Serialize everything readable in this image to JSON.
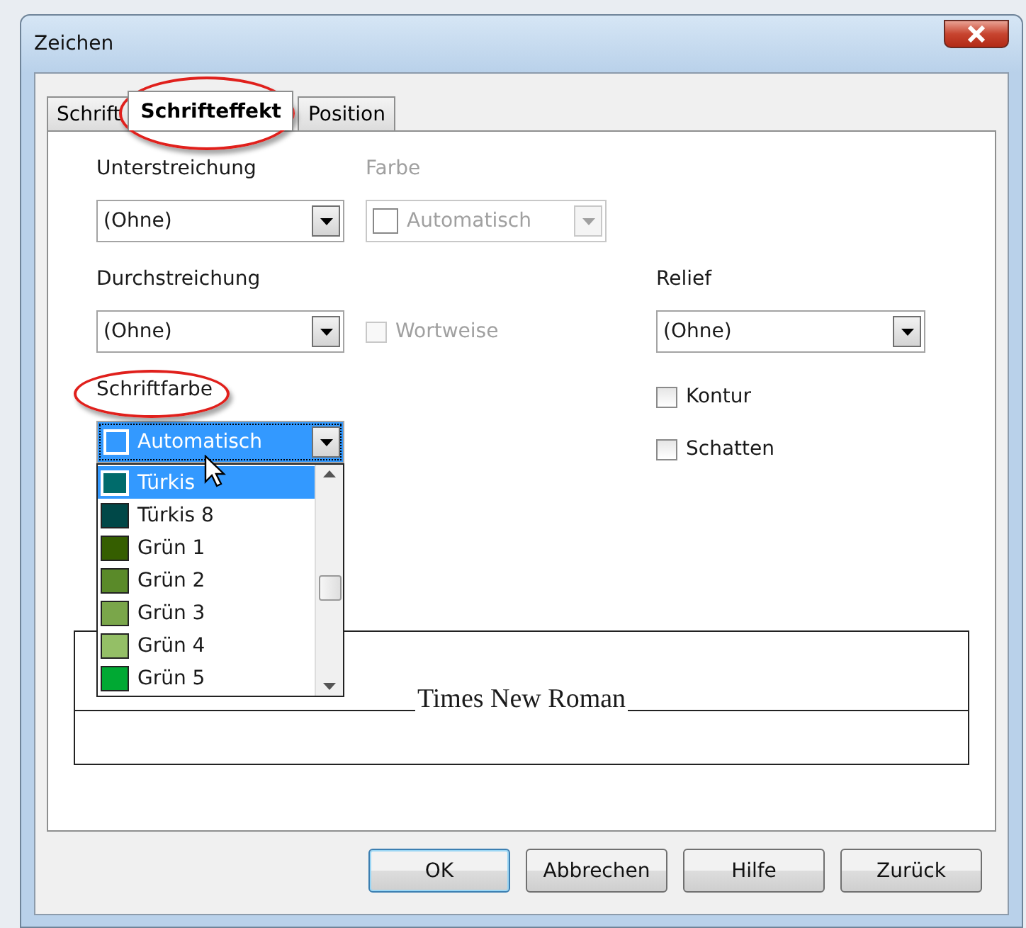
{
  "window": {
    "title": "Zeichen"
  },
  "tabs": [
    {
      "label": "Schrift",
      "selected": false,
      "highlighted": false
    },
    {
      "label": "Schrifteffekt",
      "selected": true,
      "highlighted": true
    },
    {
      "label": "Position",
      "selected": false,
      "highlighted": false
    }
  ],
  "underline": {
    "label": "Unterstreichung",
    "value": "(Ohne)",
    "disabled": false
  },
  "underline_color": {
    "label": "Farbe",
    "value": "Automatisch",
    "disabled": true
  },
  "strikethrough": {
    "label": "Durchstreichung",
    "value": "(Ohne)",
    "disabled": false
  },
  "word_by_word": {
    "label": "Wortweise",
    "checked": false,
    "disabled": true
  },
  "relief": {
    "label": "Relief",
    "value": "(Ohne)",
    "disabled": false
  },
  "outline": {
    "label": "Kontur",
    "checked": false,
    "disabled": false
  },
  "shadow": {
    "label": "Schatten",
    "checked": false,
    "disabled": false
  },
  "font_color": {
    "label": "Schriftfarbe",
    "highlighted": true,
    "value": "Automatisch",
    "expanded": true,
    "options": [
      {
        "label": "Türkis",
        "color": "#006b6b",
        "selected": true
      },
      {
        "label": "Türkis 8",
        "color": "#004848",
        "selected": false
      },
      {
        "label": "Grün 1",
        "color": "#355e00",
        "selected": false
      },
      {
        "label": "Grün 2",
        "color": "#5a8a29",
        "selected": false
      },
      {
        "label": "Grün 3",
        "color": "#7aa64a",
        "selected": false
      },
      {
        "label": "Grün 4",
        "color": "#94bf66",
        "selected": false
      },
      {
        "label": "Grün 5",
        "color": "#00a933",
        "selected": false
      }
    ]
  },
  "preview": {
    "text": "Times New Roman"
  },
  "buttons": [
    {
      "label": "OK",
      "default": true
    },
    {
      "label": "Abbrechen",
      "default": false
    },
    {
      "label": "Hilfe",
      "default": false
    },
    {
      "label": "Zurück",
      "default": false
    }
  ]
}
